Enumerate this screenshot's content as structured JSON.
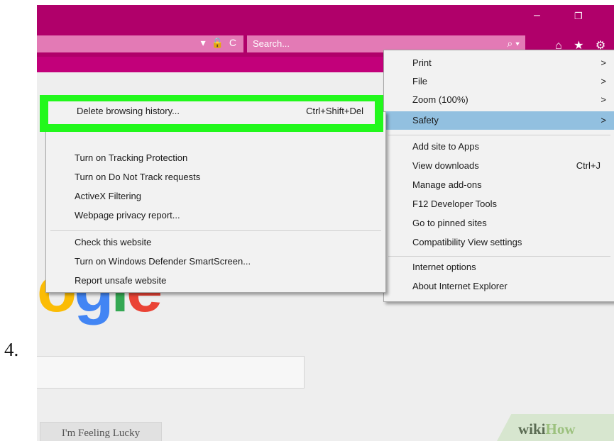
{
  "step_number": "4.",
  "window": {
    "minimize_glyph": "–",
    "restore_glyph": "❐"
  },
  "addressbar": {
    "url_icons": "▾ 🔒 C",
    "search_placeholder": "Search...",
    "search_glyph": "⌕ ▾"
  },
  "toolbar": {
    "home_glyph": "⌂",
    "favorites_glyph": "★",
    "settings_glyph": "⚙"
  },
  "google_logo": {
    "letters": [
      "o",
      "g",
      "l",
      "e"
    ]
  },
  "content": {
    "lucky_button": "I'm Feeling Lucky"
  },
  "watermark": {
    "part1": "wiki",
    "part2": "How"
  },
  "tools_menu": {
    "items": [
      {
        "label": "Print",
        "arrow": ">"
      },
      {
        "label": "File",
        "arrow": ">"
      },
      {
        "label": "Zoom (100%)",
        "arrow": ">"
      },
      {
        "label": "Safety",
        "arrow": ">",
        "highlighted": true
      },
      {
        "label": "Add site to Apps"
      },
      {
        "label": "View downloads",
        "shortcut": "Ctrl+J"
      },
      {
        "label": "Manage add-ons"
      },
      {
        "label": "F12 Developer Tools"
      },
      {
        "label": "Go to pinned sites"
      },
      {
        "label": "Compatibility View settings"
      },
      {
        "label": "Internet options"
      },
      {
        "label": "About Internet Explorer"
      }
    ]
  },
  "safety_submenu": {
    "highlighted_item": {
      "label": "Delete browsing history...",
      "shortcut": "Ctrl+Shift+Del"
    },
    "items": [
      {
        "label": "Turn on Tracking Protection"
      },
      {
        "label": "Turn on Do Not Track requests"
      },
      {
        "label": "ActiveX Filtering"
      },
      {
        "label": "Webpage privacy report..."
      },
      {
        "label": "Check this website"
      },
      {
        "label": "Turn on Windows Defender SmartScreen..."
      },
      {
        "label": "Report unsafe website"
      }
    ]
  },
  "colors": {
    "titlebar": "#b0006a",
    "highlight": "#92c0e0",
    "callout": "#22f81c"
  }
}
